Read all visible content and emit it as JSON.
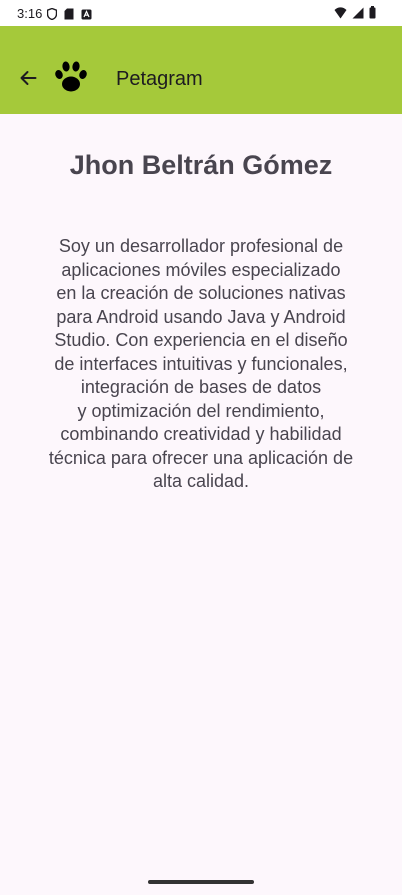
{
  "status_bar": {
    "time": "3:16",
    "left_icons": [
      "shield-icon",
      "sd-card-icon",
      "app-icon"
    ],
    "right_icons": [
      "wifi-icon",
      "cellular-signal-icon",
      "battery-icon"
    ]
  },
  "app_bar": {
    "color": "#a5c93a",
    "back_icon": "arrow-left-icon",
    "logo_icon": "paw-icon",
    "title": "Petagram"
  },
  "profile": {
    "name": "Jhon Beltrán Gómez",
    "bio_lines": [
      "Soy un desarrollador profesional de",
      "aplicaciones móviles especializado",
      "en la creación de soluciones nativas",
      "para Android usando Java y Android",
      "Studio. Con experiencia en el diseño",
      "de interfaces intuitivas y funcionales,",
      "integración de bases de datos",
      "y optimización del rendimiento,",
      "combinando creatividad y habilidad",
      "técnica para ofrecer una aplicación de",
      "alta calidad."
    ]
  }
}
